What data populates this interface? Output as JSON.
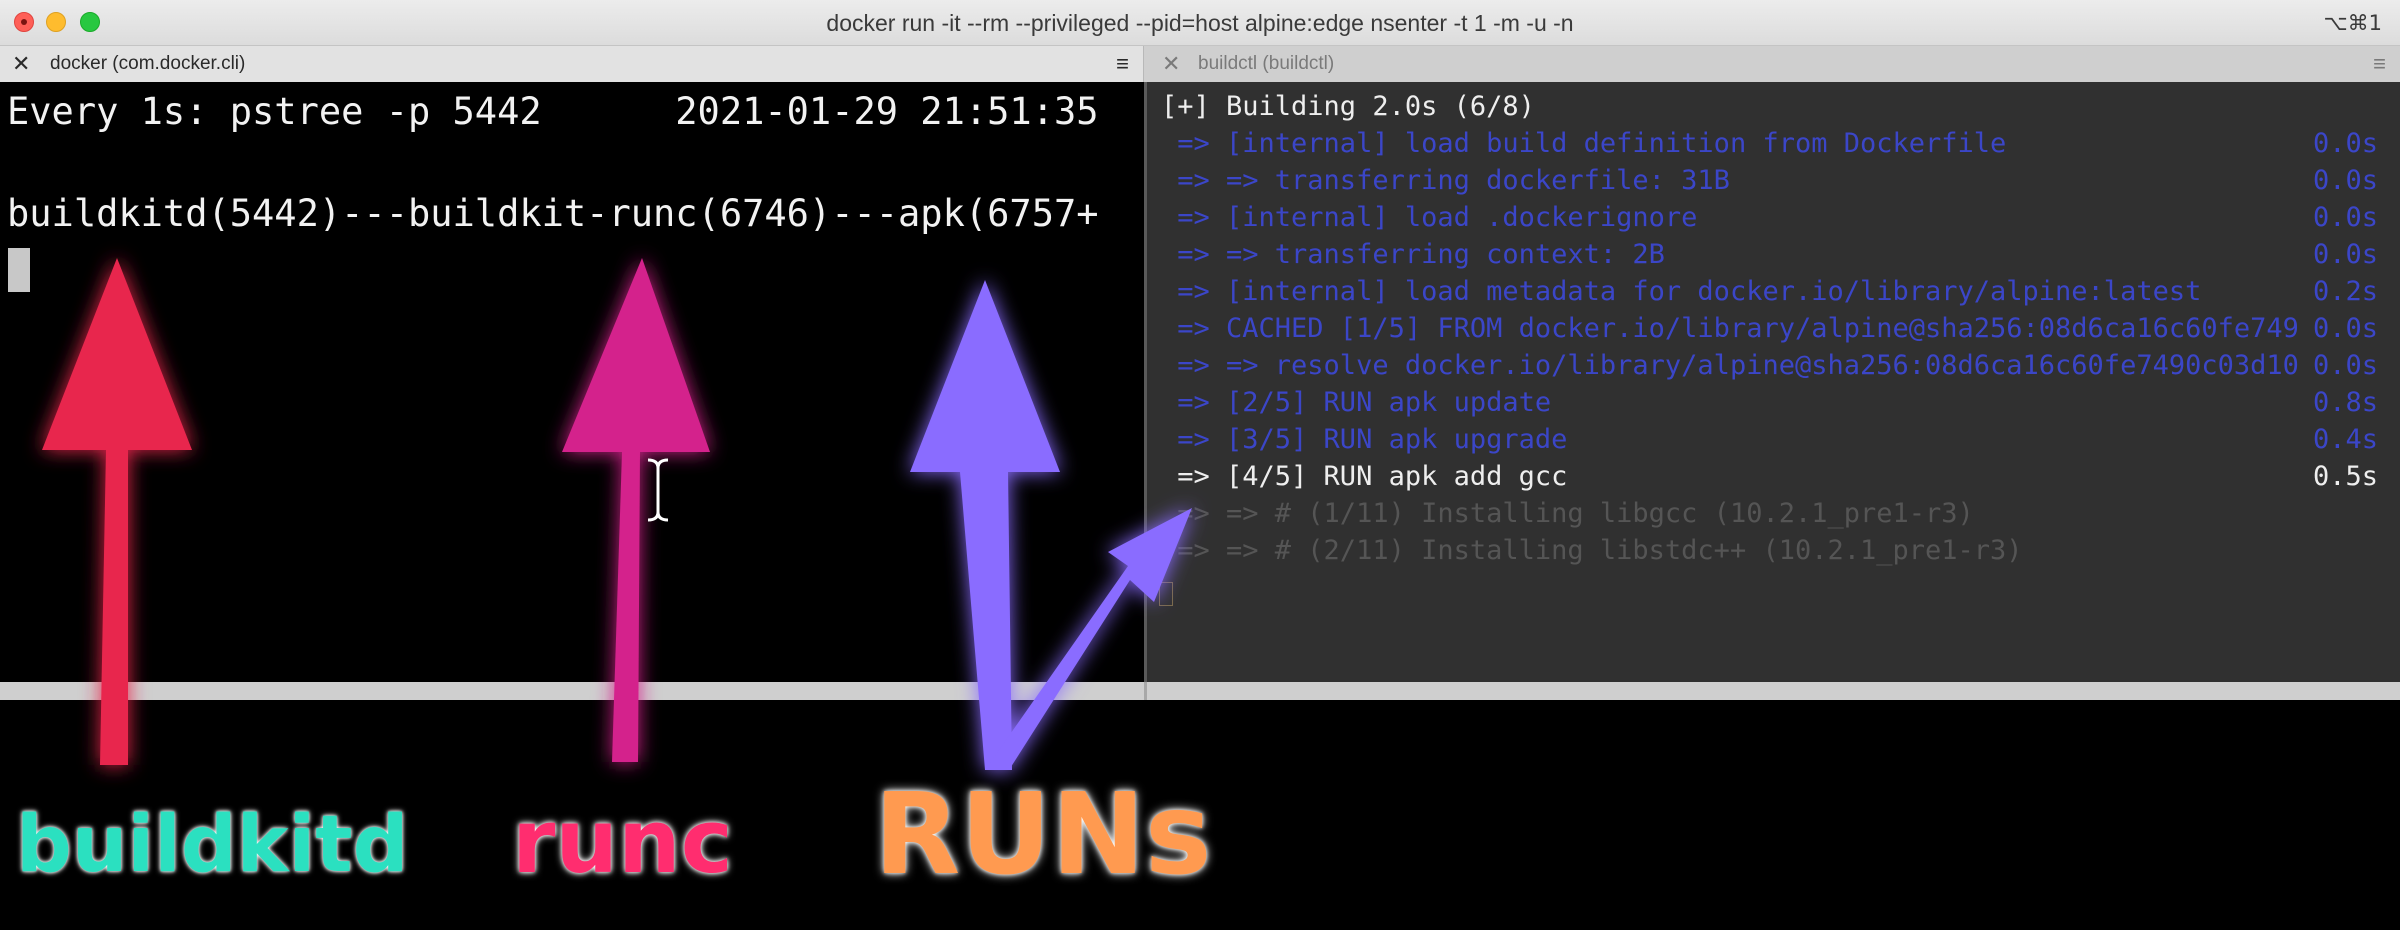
{
  "window": {
    "title": "docker run -it --rm --privileged --pid=host alpine:edge nsenter -t 1 -m -u -n",
    "shortcut": "⌥⌘1"
  },
  "tabs": [
    {
      "label": "docker (com.docker.cli)",
      "close": "✕",
      "menu": "≡"
    },
    {
      "label": "buildctl (buildctl)",
      "close": "✕",
      "menu": "≡"
    }
  ],
  "left_pane": {
    "header": "Every 1s: pstree -p 5442      2021-01-29 21:51:35",
    "tree": "buildkitd(5442)---buildkit-runc(6746)---apk(6757+"
  },
  "right_pane": {
    "lines": [
      {
        "text": "[+] Building 2.0s (6/8)",
        "time": "",
        "style": "white"
      },
      {
        "text": " => [internal] load build definition from Dockerfile",
        "time": "0.0s",
        "style": "blue"
      },
      {
        "text": " => => transferring dockerfile: 31B",
        "time": "0.0s",
        "style": "blue"
      },
      {
        "text": " => [internal] load .dockerignore",
        "time": "0.0s",
        "style": "blue"
      },
      {
        "text": " => => transferring context: 2B",
        "time": "0.0s",
        "style": "blue"
      },
      {
        "text": " => [internal] load metadata for docker.io/library/alpine:latest",
        "time": "0.2s",
        "style": "blue"
      },
      {
        "text": " => CACHED [1/5] FROM docker.io/library/alpine@sha256:08d6ca16c60fe749",
        "time": "0.0s",
        "style": "blue"
      },
      {
        "text": " => => resolve docker.io/library/alpine@sha256:08d6ca16c60fe7490c03d10",
        "time": "0.0s",
        "style": "blue"
      },
      {
        "text": " => [2/5] RUN apk update",
        "time": "0.8s",
        "style": "blue"
      },
      {
        "text": " => [3/5] RUN apk upgrade",
        "time": "0.4s",
        "style": "blue"
      },
      {
        "text": " => [4/5] RUN apk add gcc",
        "time": "0.5s",
        "style": "white"
      },
      {
        "text": " => => # (1/11) Installing libgcc (10.2.1_pre1-r3)",
        "time": "",
        "style": "dim"
      },
      {
        "text": " => => # (2/11) Installing libstdc++ (10.2.1_pre1-r3)",
        "time": "",
        "style": "dim"
      }
    ]
  },
  "annotations": {
    "buildkitd": "buildkitd",
    "runc": "runc",
    "runs": "RUNs",
    "colors": {
      "buildkitd_arrow": "#e8284e",
      "runc_arrow": "#d4208c",
      "runs_arrow": "#8a6cff",
      "buildkitd_text": "#2be0c0",
      "runc_text": "#ff2d6f",
      "runs_text": "#ff9a50"
    }
  }
}
